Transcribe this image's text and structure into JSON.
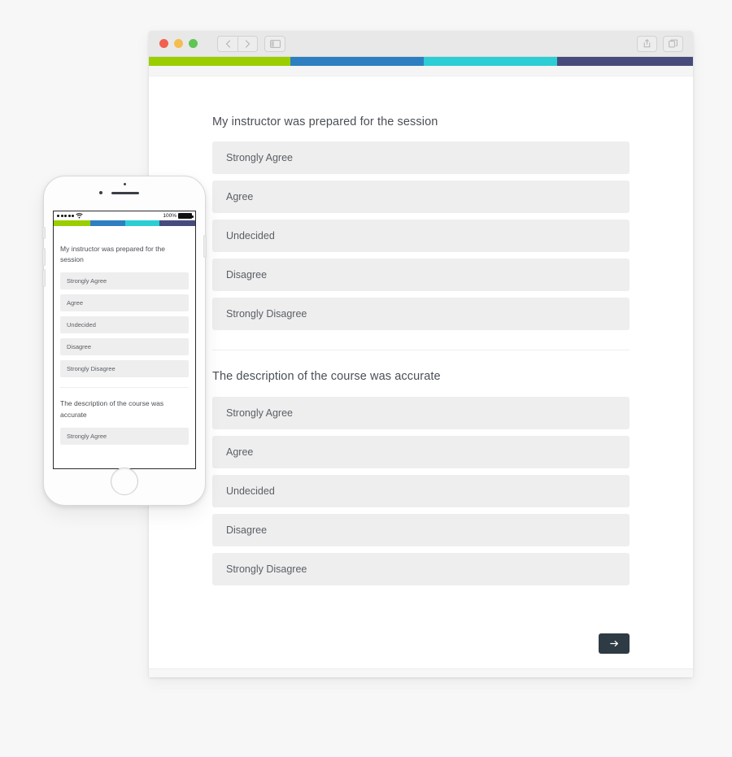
{
  "browser": {
    "traffic_lights": [
      "close",
      "minimize",
      "zoom"
    ],
    "nav": {
      "back_label": "‹",
      "forward_label": "›",
      "sidebar_icon": "sidebar-icon"
    },
    "right_actions": [
      {
        "name": "share-icon",
        "label": "share"
      },
      {
        "name": "tabs-icon",
        "label": "tabs"
      }
    ]
  },
  "theme": {
    "color_bar": [
      {
        "name": "green",
        "hex": "#9ace00",
        "width_pct": 26
      },
      {
        "name": "blue",
        "hex": "#2e7fc1",
        "width_pct": 24.5
      },
      {
        "name": "cyan",
        "hex": "#2ccdd4",
        "width_pct": 24.5
      },
      {
        "name": "indigo",
        "hex": "#474b7c",
        "width_pct": 25
      }
    ],
    "option_bg": "#eeeeee",
    "option_text": "#5a5f66",
    "title_text": "#4a4f55",
    "next_button_bg": "#2e3b44"
  },
  "survey": {
    "questions": [
      {
        "title": "My instructor was prepared for the session",
        "options": [
          "Strongly Agree",
          "Agree",
          "Undecided",
          "Disagree",
          "Strongly Disagree"
        ]
      },
      {
        "title": "The description of the course was accurate",
        "options": [
          "Strongly Agree",
          "Agree",
          "Undecided",
          "Disagree",
          "Strongly Disagree"
        ]
      }
    ],
    "next_button": {
      "icon": "arrow-right-icon",
      "label": "→"
    }
  },
  "phone": {
    "status_bar": {
      "signal_dots": 5,
      "wifi_icon": "wifi-icon",
      "battery_percent": "100%",
      "battery_icon": "battery-full-icon"
    },
    "questions": [
      {
        "title": "My instructor was prepared for the session",
        "options": [
          "Strongly Agree",
          "Agree",
          "Undecided",
          "Disagree",
          "Strongly Disagree"
        ]
      },
      {
        "title": "The description of the course was accurate",
        "options": [
          "Strongly Agree"
        ]
      }
    ]
  }
}
